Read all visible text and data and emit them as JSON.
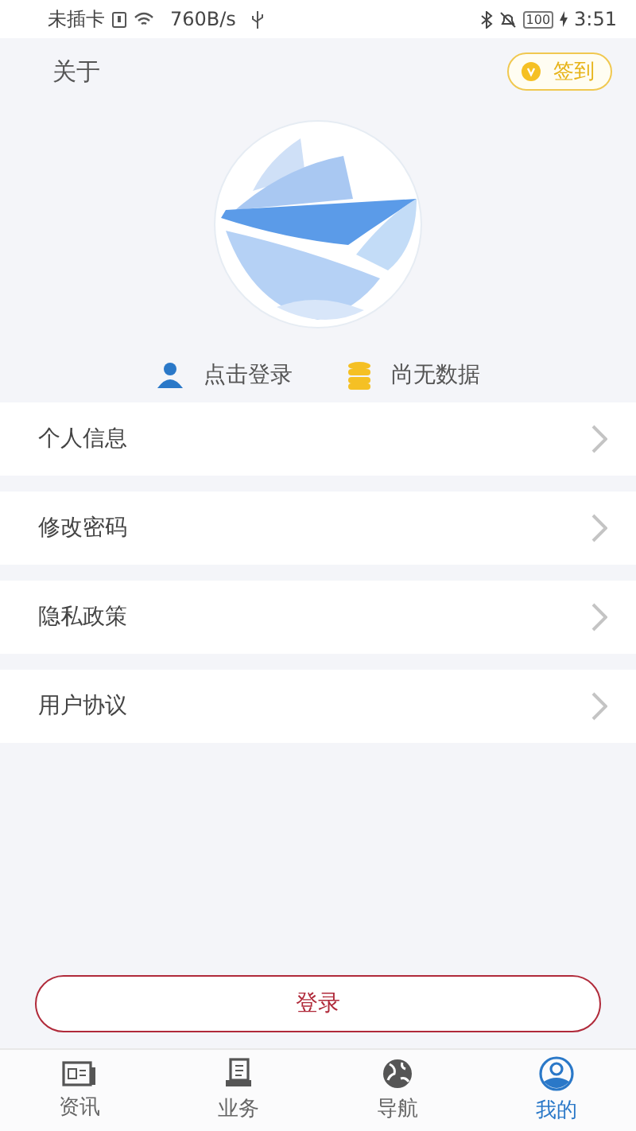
{
  "status_bar": {
    "carrier": "未插卡",
    "speed": "760B/s",
    "battery": "100",
    "time": "3:51"
  },
  "header": {
    "title": "关于",
    "checkin": "签到"
  },
  "profile": {
    "login_link": "点击登录",
    "points": "尚无数据"
  },
  "menu": [
    {
      "label": "个人信息"
    },
    {
      "label": "修改密码"
    },
    {
      "label": "隐私政策"
    },
    {
      "label": "用户协议"
    }
  ],
  "login_button": "登录",
  "tabs": [
    {
      "label": "资讯",
      "kind": "news",
      "selected": false
    },
    {
      "label": "业务",
      "kind": "docs",
      "selected": false
    },
    {
      "label": "导航",
      "kind": "globe",
      "selected": false
    },
    {
      "label": "我的",
      "kind": "person",
      "selected": true
    }
  ]
}
